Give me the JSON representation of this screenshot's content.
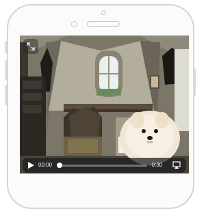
{
  "video_player": {
    "elapsed_time": "00:00",
    "remaining_time": "-0:30",
    "progress": 0.0
  },
  "icons": {
    "expand": "expand-arrows-icon",
    "play": "play-icon",
    "airplay": "airplay-icon",
    "camera": "front-camera-icon",
    "speaker": "earpiece-speaker-icon"
  },
  "colors": {
    "phone_frame": "#d4d4d4",
    "controls_bg": "#1c1c1e",
    "control_text": "#f2f2f2"
  }
}
